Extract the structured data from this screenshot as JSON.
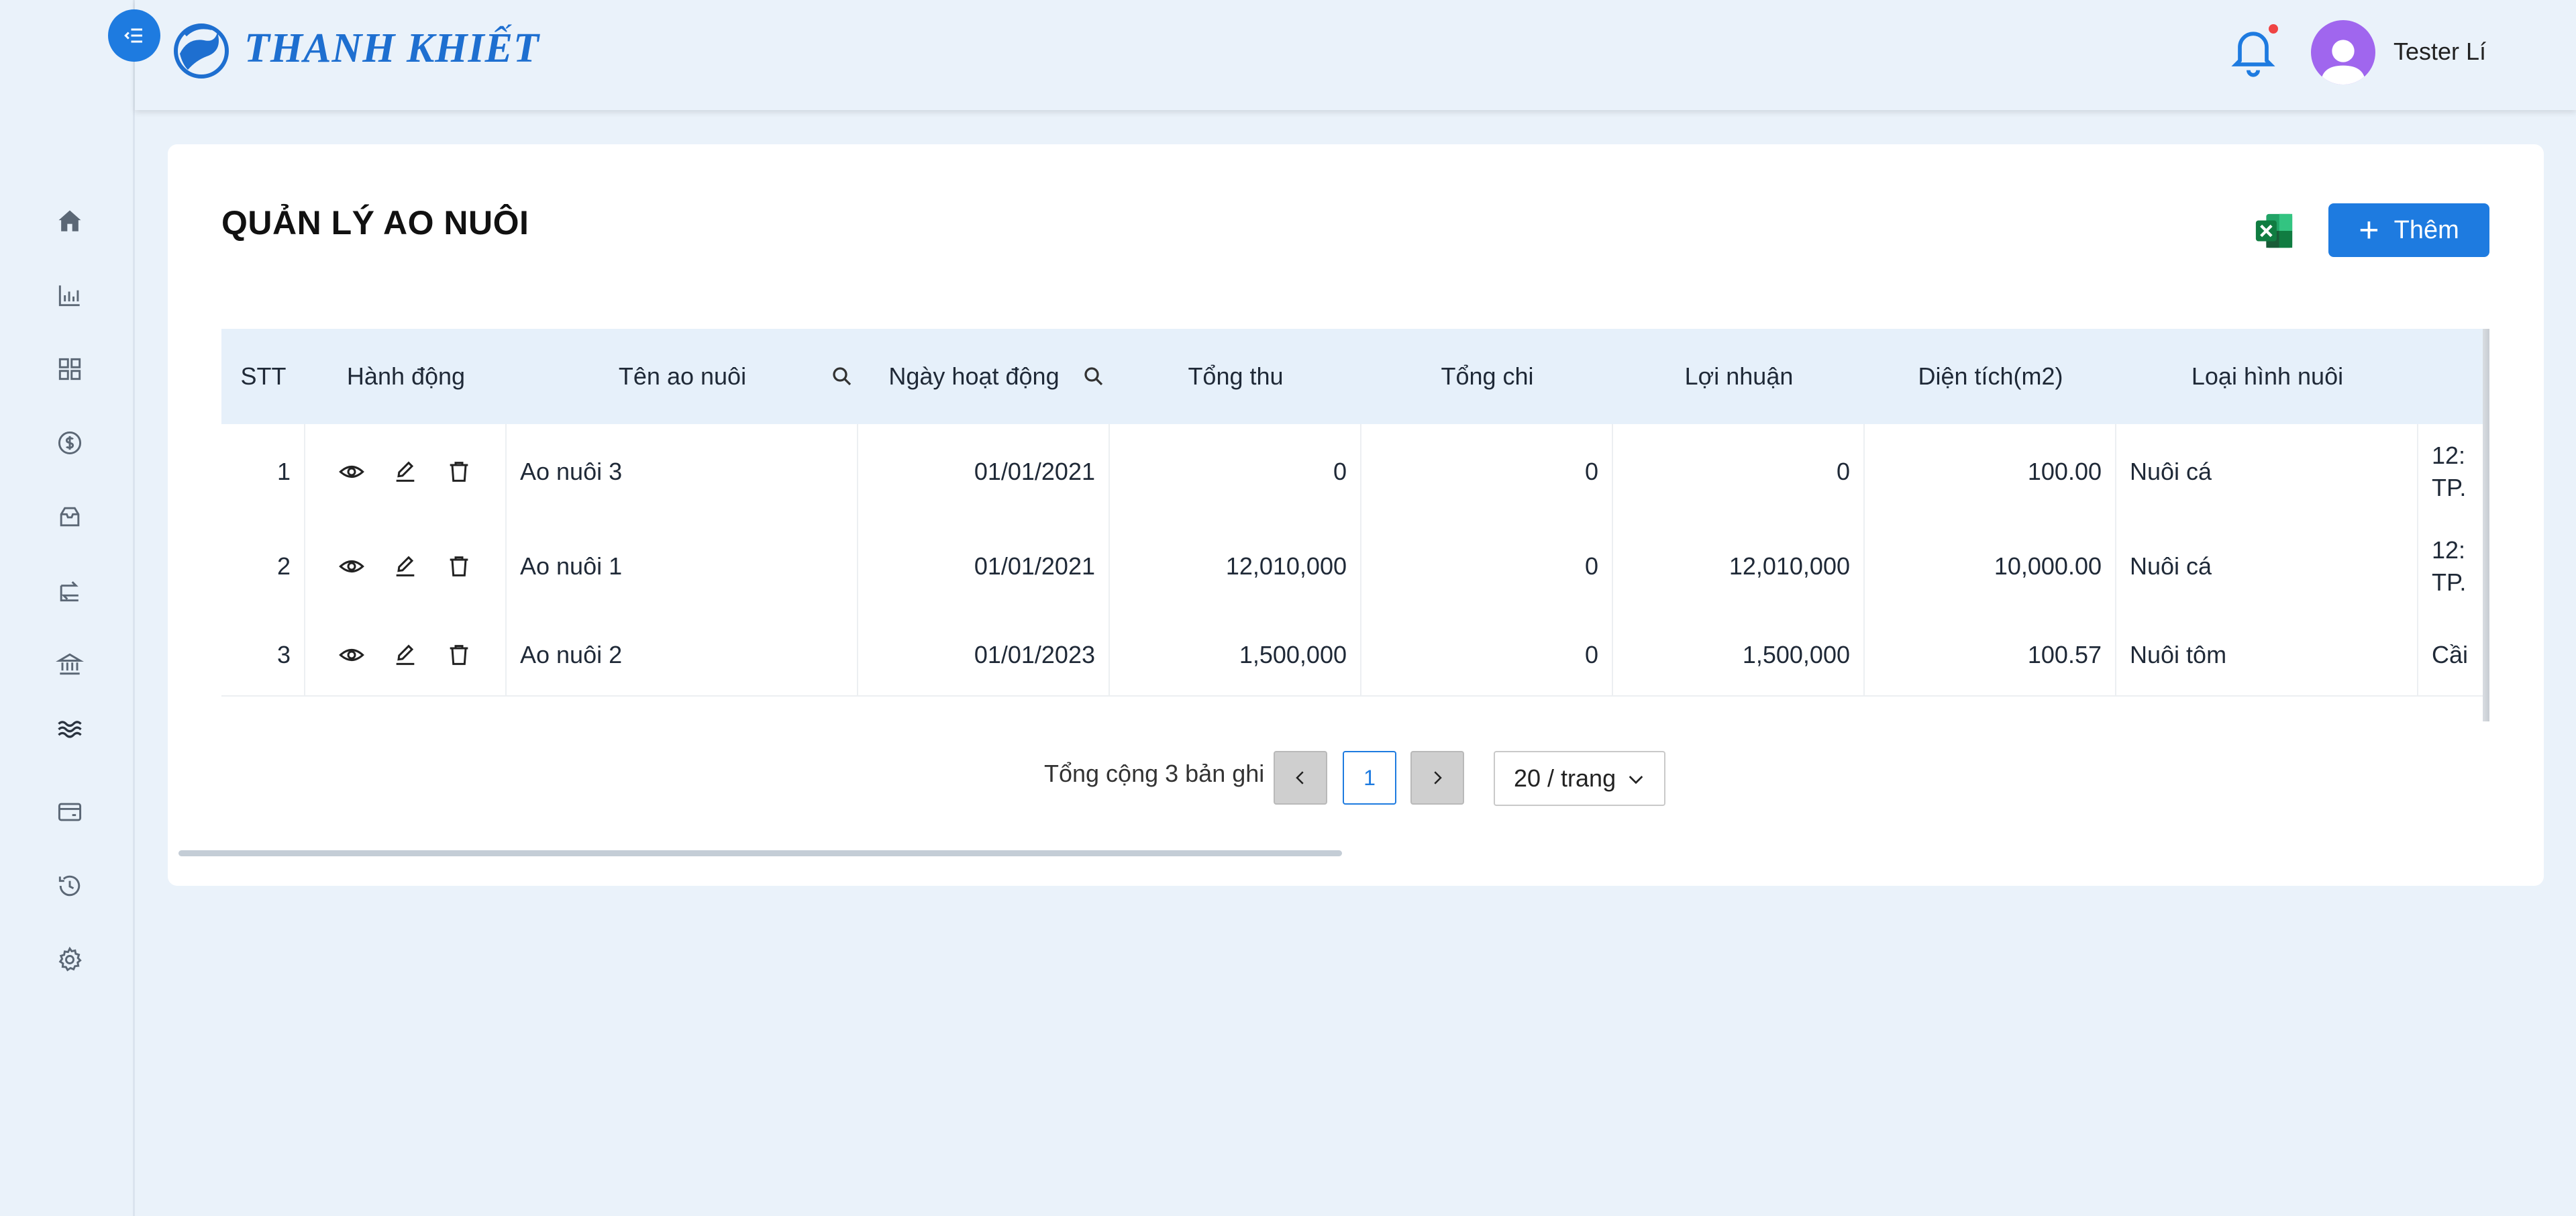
{
  "brand": {
    "name": "THANH KHIẾT"
  },
  "header": {
    "user_name": "Tester Lí",
    "notification_dot_color": "#ef4444",
    "accent": "#1e7be0"
  },
  "sidebar": {
    "items": [
      {
        "icon": "home-icon"
      },
      {
        "icon": "bar-chart-icon"
      },
      {
        "icon": "grid-icon"
      },
      {
        "icon": "dollar-circle-icon"
      },
      {
        "icon": "inbox-icon"
      },
      {
        "icon": "transfer-icon"
      },
      {
        "icon": "bank-icon"
      },
      {
        "icon": "waves-icon"
      },
      {
        "icon": "wallet-icon"
      },
      {
        "icon": "history-icon"
      },
      {
        "icon": "settings-icon"
      }
    ]
  },
  "page": {
    "title": "QUẢN LÝ AO NUÔI",
    "add_label": "Thêm",
    "excel_icon": "excel-icon"
  },
  "table": {
    "columns": [
      "STT",
      "Hành động",
      "Tên ao nuôi",
      "Ngày hoạt động",
      "Tổng thu",
      "Tổng chi",
      "Lợi nhuận",
      "Diện tích(m2)",
      "Loại hình nuôi"
    ],
    "rows": [
      {
        "stt": "1",
        "name": "Ao nuôi 3",
        "date": "01/01/2021",
        "revenue": "0",
        "expense": "0",
        "profit": "0",
        "area": "100.00",
        "type": "Nuôi cá",
        "addr1": "12:",
        "addr2": "TP."
      },
      {
        "stt": "2",
        "name": "Ao nuôi 1",
        "date": "01/01/2021",
        "revenue": "12,010,000",
        "expense": "0",
        "profit": "12,010,000",
        "area": "10,000.00",
        "type": "Nuôi cá",
        "addr1": "12:",
        "addr2": "TP."
      },
      {
        "stt": "3",
        "name": "Ao nuôi 2",
        "date": "01/01/2023",
        "revenue": "1,500,000",
        "expense": "0",
        "profit": "1,500,000",
        "area": "100.57",
        "type": "Nuôi tôm",
        "addr1": "Cầi",
        "addr2": ""
      }
    ]
  },
  "pagination": {
    "total_text": "Tổng cộng 3 bản ghi",
    "current_page": "1",
    "page_size": "20 / trang"
  }
}
